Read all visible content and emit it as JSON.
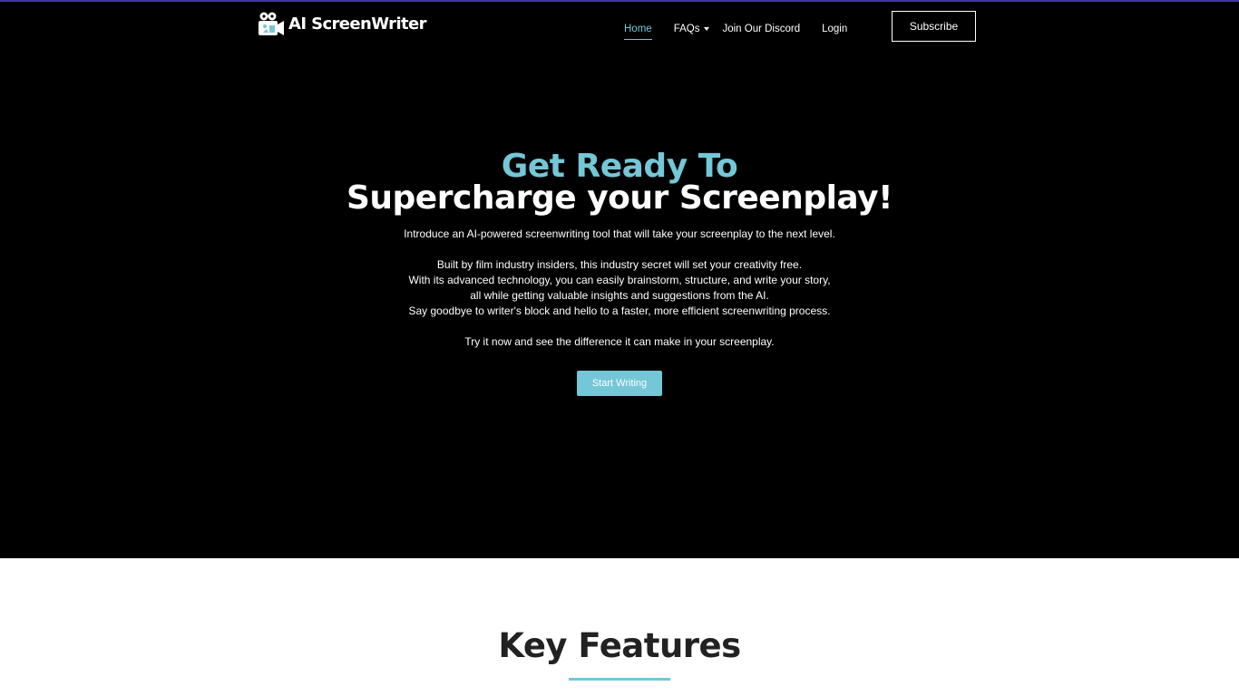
{
  "brand": {
    "name": "AI ScreenWriter",
    "logo_icon": "film-camera-icon"
  },
  "nav": {
    "items": [
      {
        "label": "Home",
        "active": true
      },
      {
        "label": "FAQs",
        "dropdown": true
      },
      {
        "label": "Join Our Discord"
      },
      {
        "label": "Login"
      }
    ],
    "subscribe_label": "Subscribe"
  },
  "hero": {
    "headline_1": "Get Ready To",
    "headline_2": "Supercharge your Screenplay!",
    "intro": "Introduce an AI-powered screenwriting tool that will take your screenplay to the next level.",
    "body_lines": [
      "Built by film industry insiders, this industry secret will set your creativity free.",
      "With its advanced technology, you can easily brainstorm, structure, and write your story,",
      "all while getting valuable insights and suggestions from the AI.",
      "Say goodbye to writer's block and hello to a faster, more efficient screenwriting process."
    ],
    "closing": "Try it now and see the difference it can make in your screenplay.",
    "cta_label": "Start Writing"
  },
  "features": {
    "title": "Key Features"
  },
  "colors": {
    "accent": "#74c7d6",
    "hero_background": "#000000",
    "top_border": "#3b3aa5",
    "heading_dark": "#222222"
  }
}
